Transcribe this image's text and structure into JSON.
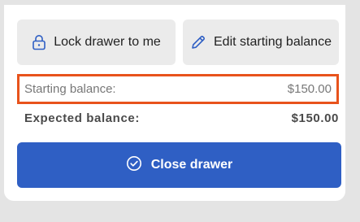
{
  "actions": {
    "lock_label": "Lock drawer to me",
    "lock_icon": "lock-icon",
    "edit_label": "Edit starting balance",
    "edit_icon": "pencil-icon"
  },
  "balances": {
    "starting_label": "Starting balance:",
    "starting_value": "$150.00",
    "expected_label": "Expected balance:",
    "expected_value": "$150.00"
  },
  "close": {
    "label": "Close drawer",
    "icon": "check-circle-icon"
  },
  "colors": {
    "primary": "#2f5fc4",
    "highlight": "#e8531c"
  }
}
